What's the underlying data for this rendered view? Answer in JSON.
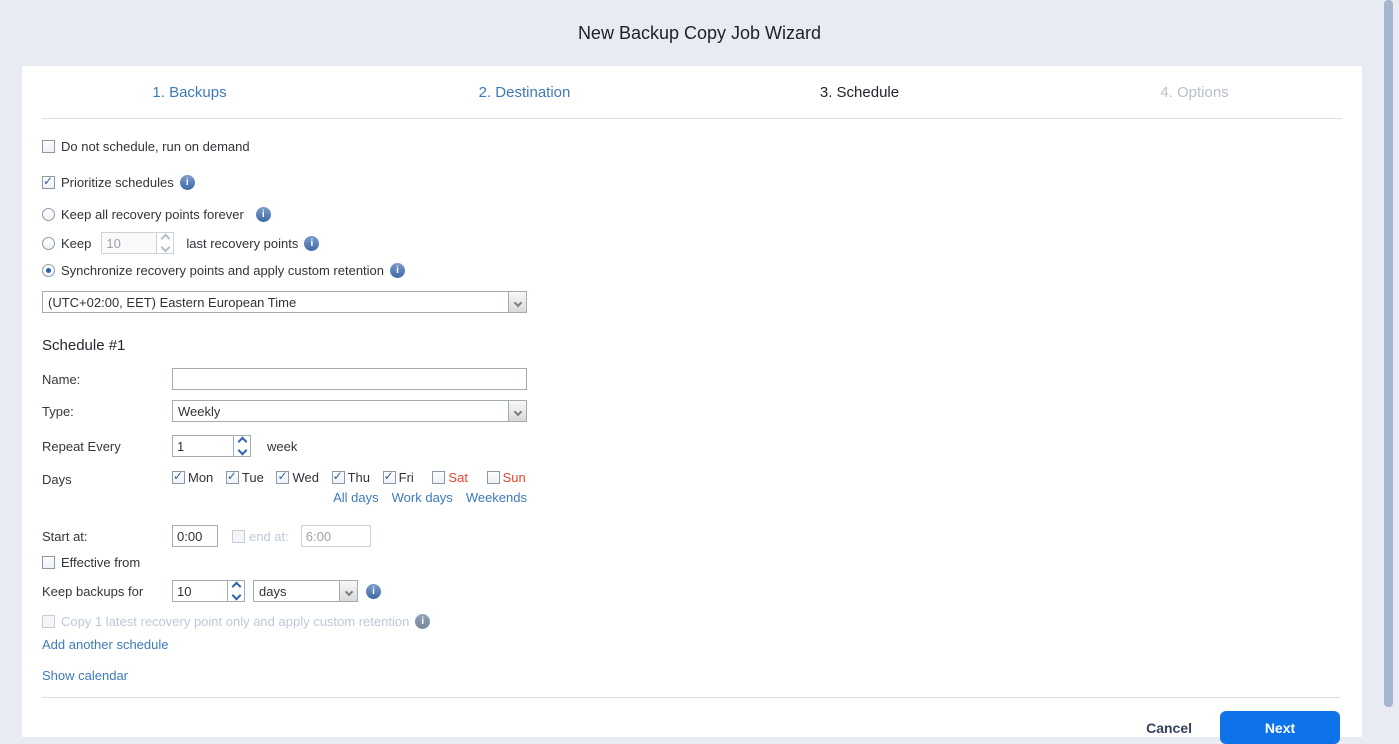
{
  "window": {
    "title": "New Backup Copy Job Wizard"
  },
  "tabs": [
    {
      "label": "1. Backups"
    },
    {
      "label": "2. Destination"
    },
    {
      "label": "3. Schedule"
    },
    {
      "label": "4. Options"
    }
  ],
  "options": {
    "do_not_schedule": "Do not schedule, run on demand",
    "prioritize": "Prioritize schedules",
    "keep_forever": "Keep all recovery points forever",
    "keep_prefix": "Keep",
    "keep_value": "10",
    "keep_suffix": "last recovery points",
    "synchronize": "Synchronize recovery points and apply custom retention",
    "timezone": "(UTC+02:00, EET) Eastern European Time"
  },
  "schedule1": {
    "heading": "Schedule #1",
    "name_label": "Name:",
    "name_value": "",
    "type_label": "Type:",
    "type_value": "Weekly",
    "repeat_label": "Repeat Every",
    "repeat_value": "1",
    "repeat_unit": "week",
    "days_label": "Days",
    "days": [
      {
        "label": "Mon",
        "checked": true
      },
      {
        "label": "Tue",
        "checked": true
      },
      {
        "label": "Wed",
        "checked": true
      },
      {
        "label": "Thu",
        "checked": true
      },
      {
        "label": "Fri",
        "checked": true
      },
      {
        "label": "Sat",
        "checked": false,
        "weekend": true
      },
      {
        "label": "Sun",
        "checked": false,
        "weekend": true
      }
    ],
    "day_links": [
      "All days",
      "Work days",
      "Weekends"
    ],
    "start_label": "Start at:",
    "start_value": "0:00",
    "end_label": "end at:",
    "end_value": "6:00",
    "effective_label": "Effective from",
    "keep_label": "Keep backups for",
    "keep_value": "10",
    "keep_unit": "days",
    "copy_latest": "Copy 1 latest recovery point only and apply custom retention",
    "add_schedule_link": "Add another schedule",
    "show_calendar_link": "Show calendar"
  },
  "footer": {
    "cancel": "Cancel",
    "next": "Next"
  },
  "colors": {
    "page_background": "#e9ebf3",
    "accent_blue": "#0e73e8",
    "link_blue": "#3d7ab9",
    "weekend_red": "#e8432c",
    "info_icon_blue": "#476fad",
    "cancel_text": "#33415c",
    "scrollbar_thumb": "#a6b5d0"
  }
}
